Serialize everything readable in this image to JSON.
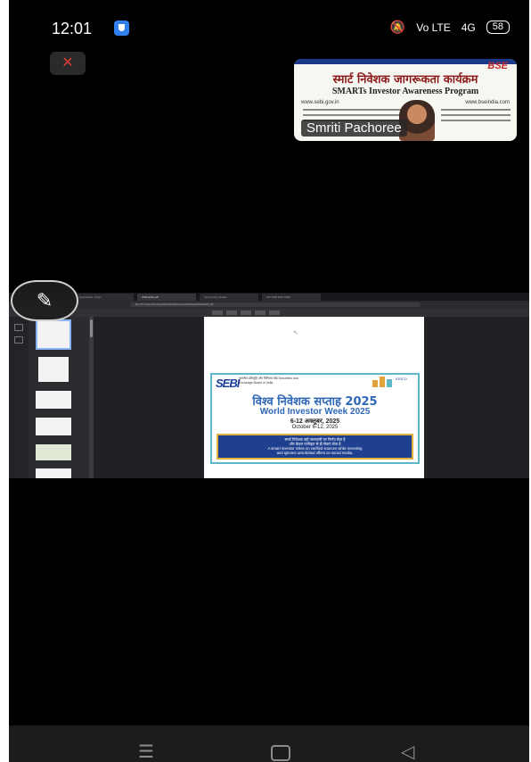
{
  "status": {
    "time": "12:01",
    "network": "Vo LTE",
    "signal": "4G",
    "battery": "58"
  },
  "meeting": {
    "participant_name": "Smriti Pachoree",
    "thumbnail": {
      "brand": "BSE",
      "line1": "स्मार्ट निवेशक जागरूकता कार्यक्रम",
      "line2": "SMARTs Investor Awareness Program",
      "link_left": "www.sebi.gov.in",
      "link_right": "www.bseindia.com"
    }
  },
  "shared_screen": {
    "active_tab": "WIW-ENG.pdf",
    "tabs": [
      "Dashboard - Zoom",
      "WIW-ENG.pdf",
      "Opportunity Details",
      "AW 2025 BSE SEBI"
    ],
    "url": "file:///C:/Users/Desktop/World%20Investor%20Week%202025.pdf",
    "pdf_page": {
      "org": "SEBI",
      "org_subtitle": "भारतीय प्रतिभूति और विनिमय बोर्ड Securities and Exchange Board of India",
      "partner": "IOSCO",
      "title_hindi": "विश्व निवेशक सप्ताह 2025",
      "title_english": "World Investor Week 2025",
      "dates_hindi": "6-12 अक्तूबर, 2025",
      "dates_english": "October 6-12, 2025",
      "message": [
        "स्मार्ट निवेशक वही जानकारी पर निर्णय लेता है",
        "और केवल पंजीकृत से ही सेवाएं लेता है",
        "A smart investor relies on verified sources while investing",
        "and ignores unsolicited offers on social media."
      ]
    }
  },
  "icons": {
    "mic": "mic-muted-icon",
    "pencil": "pencil-icon",
    "nav_menu": "recent-apps-icon",
    "nav_home": "home-icon",
    "nav_back": "back-icon"
  },
  "colors": {
    "background": "#000000",
    "sebi_blue": "#1b3f9a",
    "poster_border": "#5fb8c7",
    "msg_box": "#1f3f8f"
  }
}
